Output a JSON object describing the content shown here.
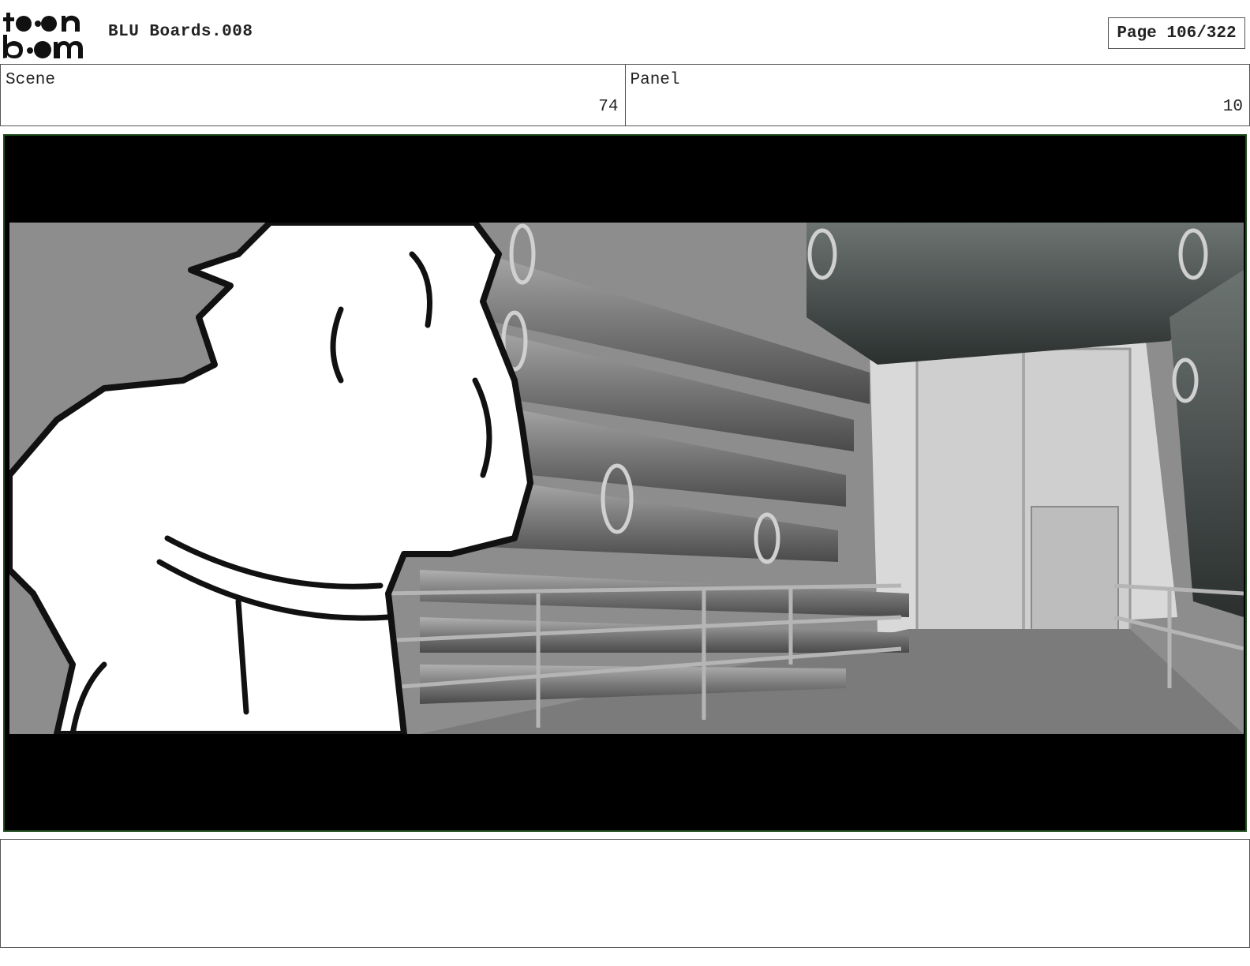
{
  "header": {
    "logo_text": "toon boom",
    "project_title": "BLU Boards.008",
    "page_label": "Page 106/322"
  },
  "scene": {
    "label": "Scene",
    "value": "74"
  },
  "panel": {
    "label": "Panel",
    "value": "10"
  },
  "notes": {
    "text": ""
  },
  "colors": {
    "frame_border": "#1d4d1d",
    "letterbox": "#000000"
  }
}
